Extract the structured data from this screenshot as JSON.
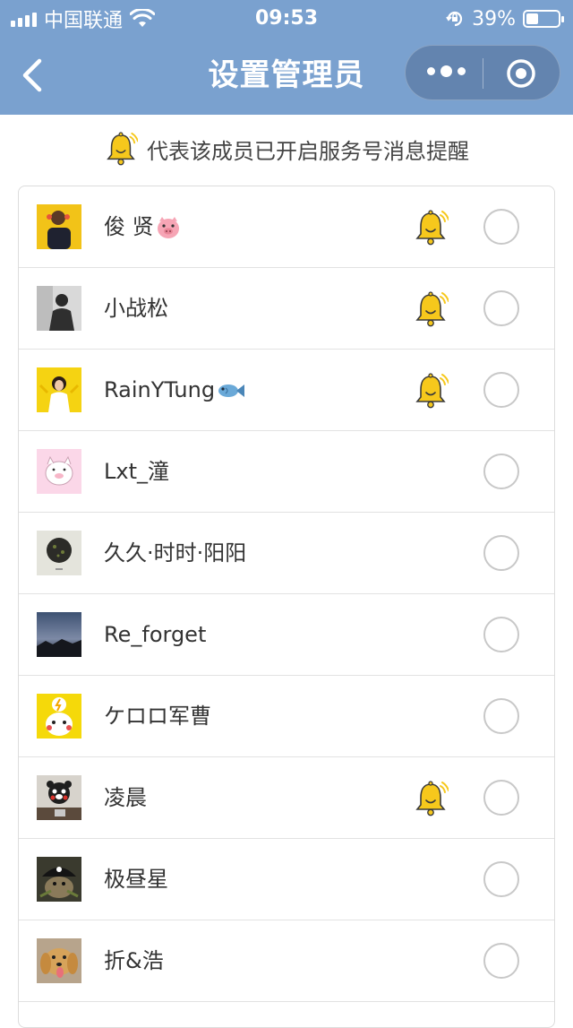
{
  "status_bar": {
    "carrier": "中国联通",
    "time": "09:53",
    "battery": "39%",
    "battery_level": 0.39
  },
  "nav": {
    "title": "设置管理员",
    "back_icon": "back-chevron-icon",
    "more_icon": "more-dots-icon",
    "close_icon": "target-circle-icon"
  },
  "hint": {
    "text": "代表该成员已开启服务号消息提醒",
    "icon": "bell-icon"
  },
  "colors": {
    "nav_bg": "#7aa1cf",
    "bell_yellow": "#f6c81c"
  },
  "members": [
    {
      "name": "俊 贤",
      "emoji": "pig-face-icon",
      "bell": true,
      "avatar": "avatar-yellow-photo"
    },
    {
      "name": "小战松",
      "emoji": "",
      "bell": true,
      "avatar": "avatar-grey-photo"
    },
    {
      "name": "RainYTung",
      "emoji": "fish-icon",
      "bell": true,
      "avatar": "avatar-yellow-girl"
    },
    {
      "name": "Lxt_潼",
      "emoji": "",
      "bell": false,
      "avatar": "avatar-pink-cartoon"
    },
    {
      "name": "久久·时时·阳阳",
      "emoji": "",
      "bell": false,
      "avatar": "avatar-dark-object"
    },
    {
      "name": "Re_forget",
      "emoji": "",
      "bell": false,
      "avatar": "avatar-dusk-sky"
    },
    {
      "name": "ケロロ军曹",
      "emoji": "",
      "bell": false,
      "avatar": "avatar-pikachu"
    },
    {
      "name": "凌晨",
      "emoji": "",
      "bell": true,
      "avatar": "avatar-kumamon"
    },
    {
      "name": "极昼星",
      "emoji": "",
      "bell": false,
      "avatar": "avatar-pirate-dog"
    },
    {
      "name": "折&浩",
      "emoji": "",
      "bell": false,
      "avatar": "avatar-golden-dog"
    }
  ]
}
